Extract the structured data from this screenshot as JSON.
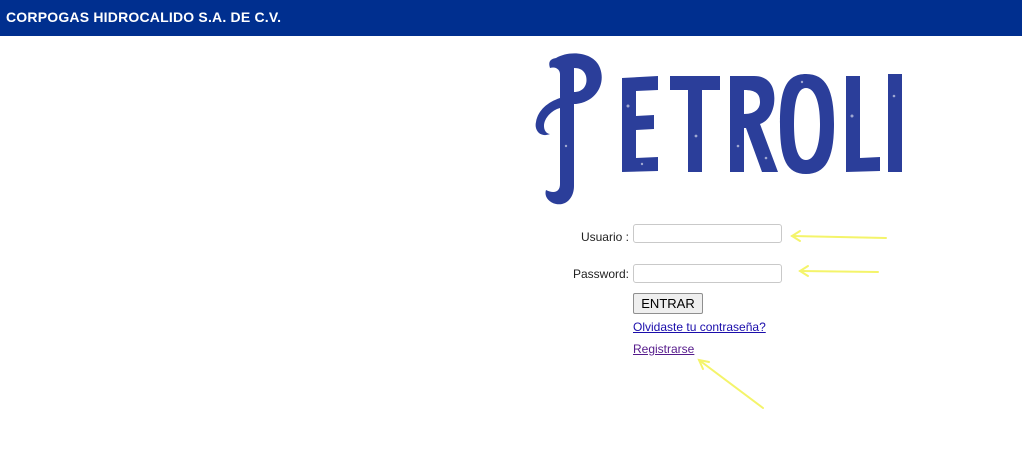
{
  "header": {
    "company_name": "CORPOGAS HIDROCALIDO S.A. DE C.V.",
    "background_color": "#002f8f"
  },
  "logo": {
    "text": "PETROLI",
    "color": "#2b3e9a"
  },
  "login_form": {
    "usuario_label": "Usuario :",
    "usuario_value": "",
    "password_label": "Password:",
    "password_value": "",
    "submit_label": "ENTRAR",
    "forgot_link": "Olvidaste tu contraseña?",
    "register_link": "Registrarse"
  },
  "annotations": {
    "arrow_color": "#f4f46a"
  }
}
